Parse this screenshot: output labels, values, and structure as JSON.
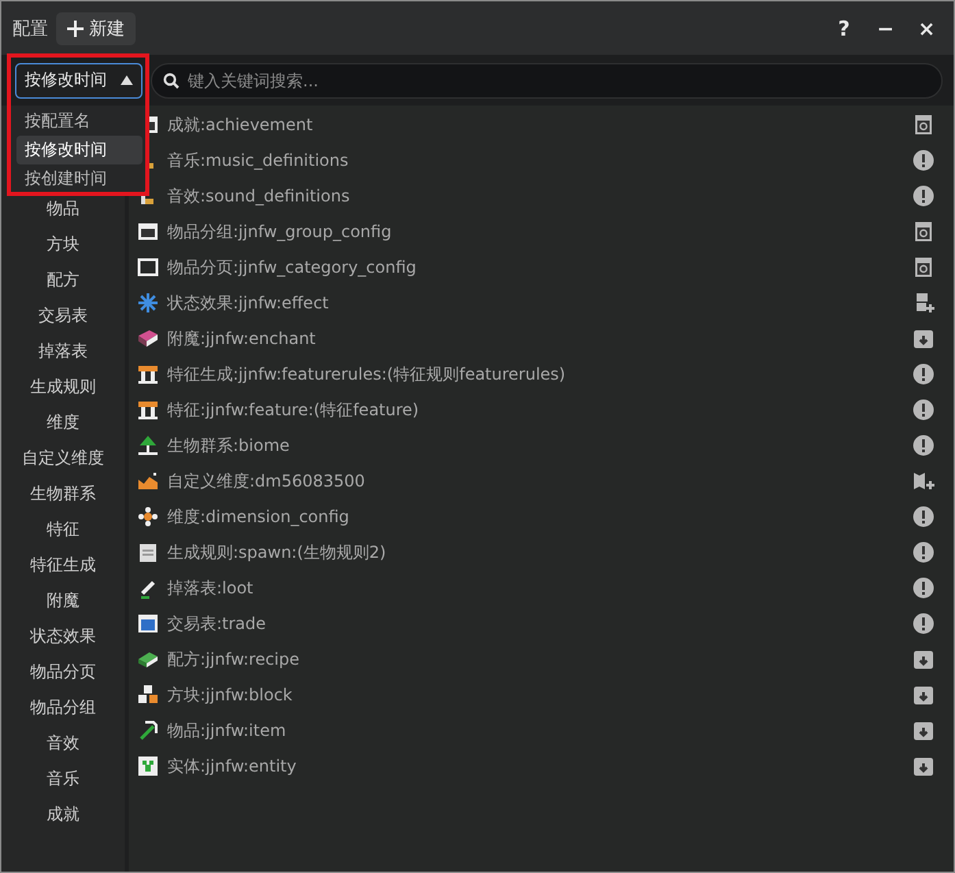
{
  "window": {
    "title": "配置",
    "new_button": "新建",
    "controls": [
      "?",
      "−",
      "×"
    ]
  },
  "sort": {
    "value": "按修改时间",
    "expanded": true,
    "options": [
      {
        "label": "按配置名",
        "selected": false
      },
      {
        "label": "按修改时间",
        "selected": true
      },
      {
        "label": "按创建时间",
        "selected": false
      }
    ]
  },
  "search": {
    "placeholder": "键入关键词搜索..."
  },
  "sidebar": {
    "items": [
      "物品",
      "方块",
      "配方",
      "交易表",
      "掉落表",
      "生成规则",
      "维度",
      "自定义维度",
      "生物群系",
      "特征",
      "特征生成",
      "附魔",
      "状态效果",
      "物品分页",
      "物品分组",
      "音效",
      "音乐",
      "成就"
    ]
  },
  "entries": [
    {
      "kind": "achievement",
      "label": "成就:achievement",
      "status": {
        "kind": "refresh"
      }
    },
    {
      "kind": "music",
      "label": "音乐:music_definitions",
      "status": {
        "kind": "warning"
      }
    },
    {
      "kind": "sound",
      "label": "音效:sound_definitions",
      "status": {
        "kind": "warning"
      }
    },
    {
      "kind": "group",
      "label": "物品分组:jjnfw_group_config",
      "status": {
        "kind": "refresh"
      }
    },
    {
      "kind": "category",
      "label": "物品分页:jjnfw_category_config",
      "status": {
        "kind": "refresh"
      }
    },
    {
      "kind": "effect",
      "label": "状态效果:jjnfw:effect",
      "status": {
        "kind": "add"
      }
    },
    {
      "kind": "enchant",
      "label": "附魔:jjnfw:enchant",
      "status": {
        "kind": "download"
      }
    },
    {
      "kind": "featurerule",
      "label": "特征生成:jjnfw:featurerules:(特征规则featurerules)",
      "status": {
        "kind": "warning"
      }
    },
    {
      "kind": "feature",
      "label": "特征:jjnfw:feature:(特征feature)",
      "status": {
        "kind": "warning"
      }
    },
    {
      "kind": "biome",
      "label": "生物群系:biome",
      "status": {
        "kind": "warning"
      }
    },
    {
      "kind": "dimension",
      "label": "自定义维度:dm56083500",
      "status": {
        "kind": "map"
      }
    },
    {
      "kind": "dimension_config",
      "label": "维度:dimension_config",
      "status": {
        "kind": "warning"
      }
    },
    {
      "kind": "spawn",
      "label": "生成规则:spawn:(生物规则2)",
      "status": {
        "kind": "warning"
      }
    },
    {
      "kind": "loot",
      "label": "掉落表:loot",
      "status": {
        "kind": "warning"
      }
    },
    {
      "kind": "trade",
      "label": "交易表:trade",
      "status": {
        "kind": "warning"
      }
    },
    {
      "kind": "recipe",
      "label": "配方:jjnfw:recipe",
      "status": {
        "kind": "download"
      }
    },
    {
      "kind": "block",
      "label": "方块:jjnfw:block",
      "status": {
        "kind": "download"
      }
    },
    {
      "kind": "item",
      "label": "物品:jjnfw:item",
      "status": {
        "kind": "download"
      }
    },
    {
      "kind": "entity",
      "label": "实体:jjnfw:entity",
      "status": {
        "kind": "download"
      }
    }
  ]
}
